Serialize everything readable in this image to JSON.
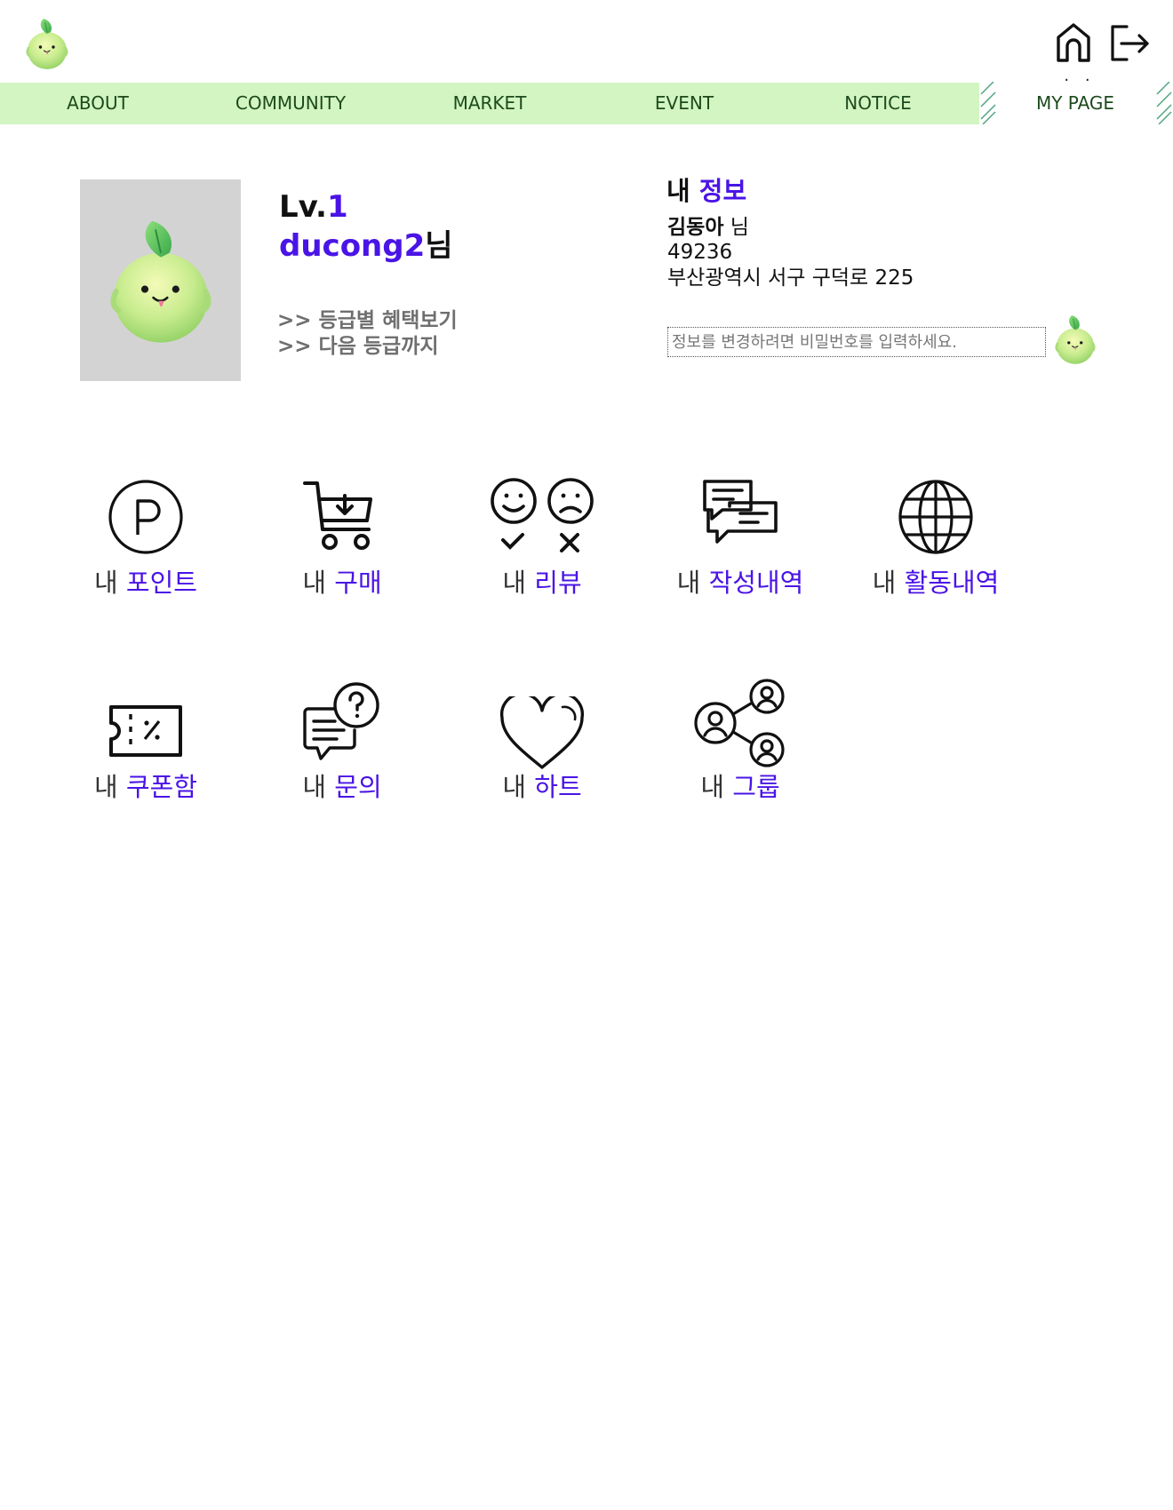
{
  "header": {
    "logo": "ducong-mascot-logo",
    "home_icon": "home-icon",
    "logout_icon": "logout-icon"
  },
  "nav": {
    "items": [
      {
        "label": "ABOUT"
      },
      {
        "label": "COMMUNITY"
      },
      {
        "label": "MARKET"
      },
      {
        "label": "EVENT"
      },
      {
        "label": "NOTICE"
      },
      {
        "label": "MY PAGE",
        "active": true
      }
    ],
    "active_indicator": ". ."
  },
  "profile": {
    "level_prefix": "Lv.",
    "level_value": "1",
    "username": "ducong2",
    "username_suffix": "님",
    "links": [
      ">> 등급별 혜택보기",
      ">> 다음 등급까지"
    ]
  },
  "info": {
    "title_prefix": "내",
    "title_highlight": "정보",
    "name": "김동아",
    "name_suffix": "님",
    "postal_code": "49236",
    "address": "부산광역시 서구 구덕로 225",
    "password_placeholder": "정보를 변경하려면 비밀번호를 입력하세요."
  },
  "menu": {
    "items": [
      {
        "prefix": "내",
        "label": "포인트",
        "icon": "point-icon"
      },
      {
        "prefix": "내",
        "label": "구매",
        "icon": "cart-icon"
      },
      {
        "prefix": "내",
        "label": "리뷰",
        "icon": "review-icon"
      },
      {
        "prefix": "내",
        "label": "작성내역",
        "icon": "chat-bubbles-icon"
      },
      {
        "prefix": "내",
        "label": "활동내역",
        "icon": "globe-icon"
      },
      {
        "prefix": "내",
        "label": "쿠폰함",
        "icon": "coupon-icon"
      },
      {
        "prefix": "내",
        "label": "문의",
        "icon": "question-chat-icon"
      },
      {
        "prefix": "내",
        "label": "하트",
        "icon": "heart-icon"
      },
      {
        "prefix": "내",
        "label": "그룹",
        "icon": "group-share-icon"
      }
    ]
  },
  "colors": {
    "accent": "#4a14e6",
    "nav_bg": "#d2f5c1",
    "nav_text": "#1d4a1d",
    "avatar_bg": "#d3d3d3",
    "grade_link": "#6f6f6f"
  }
}
